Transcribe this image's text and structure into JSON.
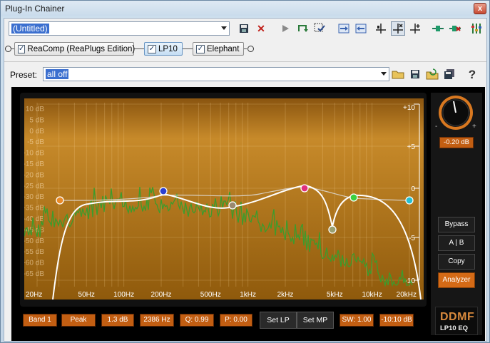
{
  "window": {
    "title": "Plug-In Chainer",
    "close_label": "x"
  },
  "toolbar": {
    "chain_name": "(Untitled)",
    "icons": [
      "save-icon",
      "delete-icon",
      "play-icon",
      "loop-icon",
      "select-icon",
      "move-in-icon",
      "move-out-icon",
      "align-left-icon",
      "align-x-icon",
      "align-plus-icon",
      "add-plugin-icon",
      "remove-plugin-icon",
      "mixer-icon"
    ]
  },
  "chain": {
    "plugins": [
      {
        "label": "ReaComp (ReaPlugs Edition)",
        "checked": true,
        "active": false
      },
      {
        "label": "LP10",
        "checked": true,
        "active": true
      },
      {
        "label": "Elephant",
        "checked": true,
        "active": false
      }
    ]
  },
  "preset": {
    "label": "Preset:",
    "value": "all off",
    "help": "?"
  },
  "eq": {
    "db_left_labels": [
      "10 dB",
      "5 dB",
      "0 dB",
      "-5 dB",
      "-10 dB",
      "-15 dB",
      "-20 dB",
      "-25 dB",
      "-30 dB",
      "-35 dB",
      "-40 dB",
      "-45 dB",
      "-50 dB",
      "-55 dB",
      "-60 dB",
      "-65 dB"
    ],
    "db_right_labels": [
      "+10",
      "+5",
      "0",
      "-5",
      "-10"
    ],
    "freq_labels": [
      "20Hz",
      "50Hz",
      "100Hz",
      "200Hz",
      "500Hz",
      "1kHz",
      "2kHz",
      "5kHz",
      "10kHz",
      "20kHz"
    ],
    "colors": {
      "background_top": "#7a4a0e",
      "background_bottom": "#c07b19",
      "curve": "#ffffff",
      "analyzer": "#3a9a2a"
    }
  },
  "gain": {
    "value": "-0.20 dB",
    "minus": "-",
    "plus": "+"
  },
  "side_buttons": [
    {
      "label": "Bypass",
      "on": false
    },
    {
      "label": "A | B",
      "on": false
    },
    {
      "label": "Copy",
      "on": false
    },
    {
      "label": "Analyzer",
      "on": true
    }
  ],
  "params": {
    "band": "Band 1",
    "type": "Peak",
    "gain": "1.3 dB",
    "freq": "2386 Hz",
    "q": "Q: 0.99",
    "phase": "P: 0.00",
    "set_lp": "Set LP",
    "set_mp": "Set MP",
    "sw": "SW: 1.00",
    "range": "-10:10 dB"
  },
  "logo": {
    "line1": "DDMF",
    "line2": "LP10 EQ"
  }
}
